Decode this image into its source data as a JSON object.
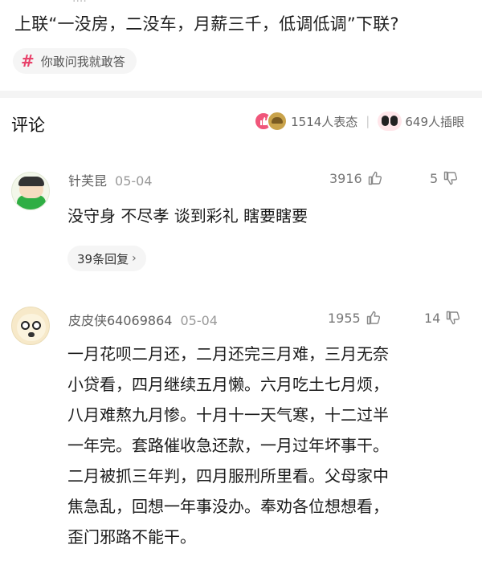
{
  "post": {
    "top_partial_text": "····",
    "body": "上联“一没房，二没车，月薪三千，低调低调”下联?",
    "topic_tag": "你敢问我就敢答"
  },
  "comments_header": {
    "title": "评论",
    "reactions_text": "1514人表态",
    "eyes_text": "649人插眼"
  },
  "comments": [
    {
      "username": "针芙昆",
      "date": "05-04",
      "likes": "3916",
      "dislikes": "5",
      "text_lines": [
        "没守身 不尽孝 谈到彩礼 瞎要瞎要"
      ],
      "replies_label": "39条回复"
    },
    {
      "username": "皮皮侠64069864",
      "date": "05-04",
      "likes": "1955",
      "dislikes": "14",
      "text_lines": [
        "一月花呗二月还，二月还完三月难，三月无奈",
        "小贷看，四月继续五月懒。六月吃土七月烦，",
        "八月难熬九月惨。十月十一天气寒，十二过半",
        "一年完。套路催收急还款，一月过年坏事干。",
        "二月被抓三年判，四月服刑所里看。父母家中",
        "焦急乱，回想一年事没办。奉劝各位想想看，",
        "歪门邪路不能干。"
      ]
    }
  ],
  "icons": {
    "topic": "hash-icon",
    "like": "thumb-up-icon",
    "dislike": "thumb-down-icon",
    "replies": "chevron-right-icon"
  },
  "colors": {
    "accent": "#e8436b",
    "like_emoji": "#f0567a"
  }
}
